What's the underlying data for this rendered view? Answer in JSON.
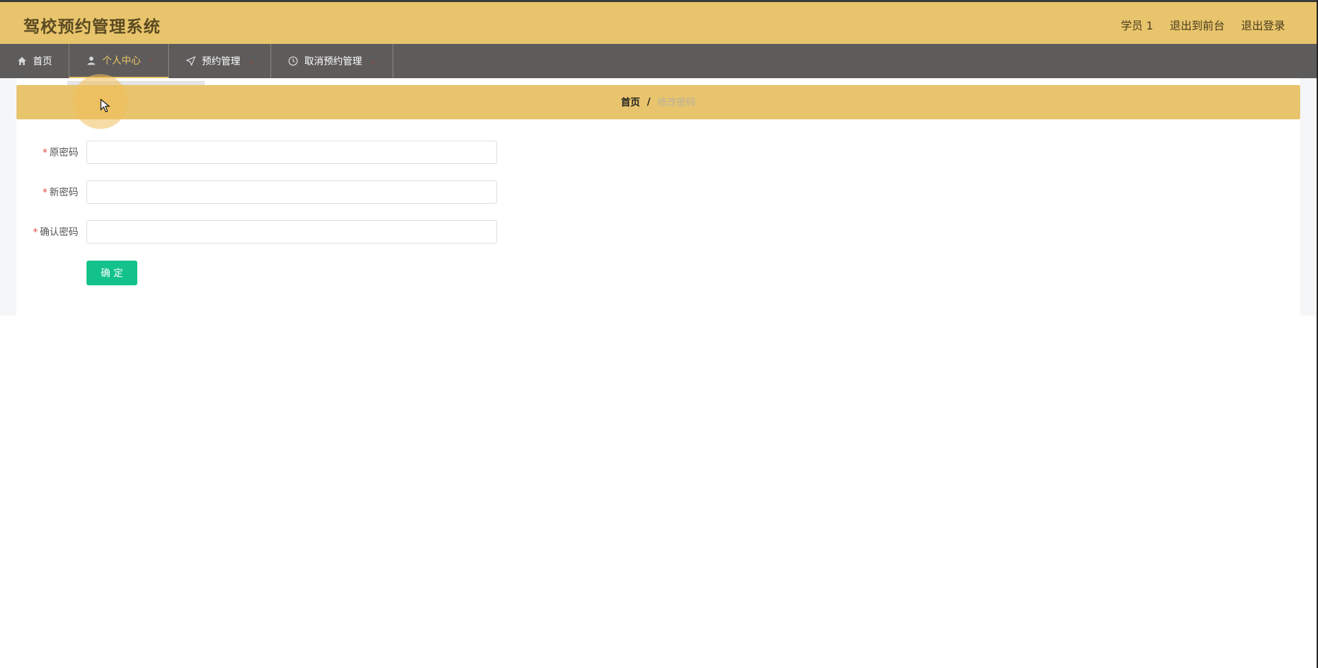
{
  "header": {
    "app_title": "驾校预约管理系统",
    "links": [
      "学员 1",
      "退出到前台",
      "退出登录"
    ]
  },
  "nav": {
    "items": [
      {
        "label": "首页",
        "icon": "home-icon",
        "active": false
      },
      {
        "label": "个人中心",
        "icon": "user-icon",
        "active": true
      },
      {
        "label": "预约管理",
        "icon": "send-icon",
        "active": false
      },
      {
        "label": "取消预约管理",
        "icon": "clock-icon",
        "active": false
      }
    ]
  },
  "breadcrumb": {
    "home": "首页",
    "separator": "/",
    "current": "修改密码"
  },
  "form": {
    "fields": [
      {
        "label": "原密码",
        "required_mark": "*",
        "value": ""
      },
      {
        "label": "新密码",
        "required_mark": "*",
        "value": ""
      },
      {
        "label": "确认密码",
        "required_mark": "*",
        "value": ""
      }
    ],
    "submit_label": "确 定"
  },
  "colors": {
    "header_bg": "#e8c46c",
    "nav_bg": "#5e5c5b",
    "active_accent": "#f0c767",
    "submit_bg": "#13c28a",
    "required_mark": "#e04848"
  }
}
